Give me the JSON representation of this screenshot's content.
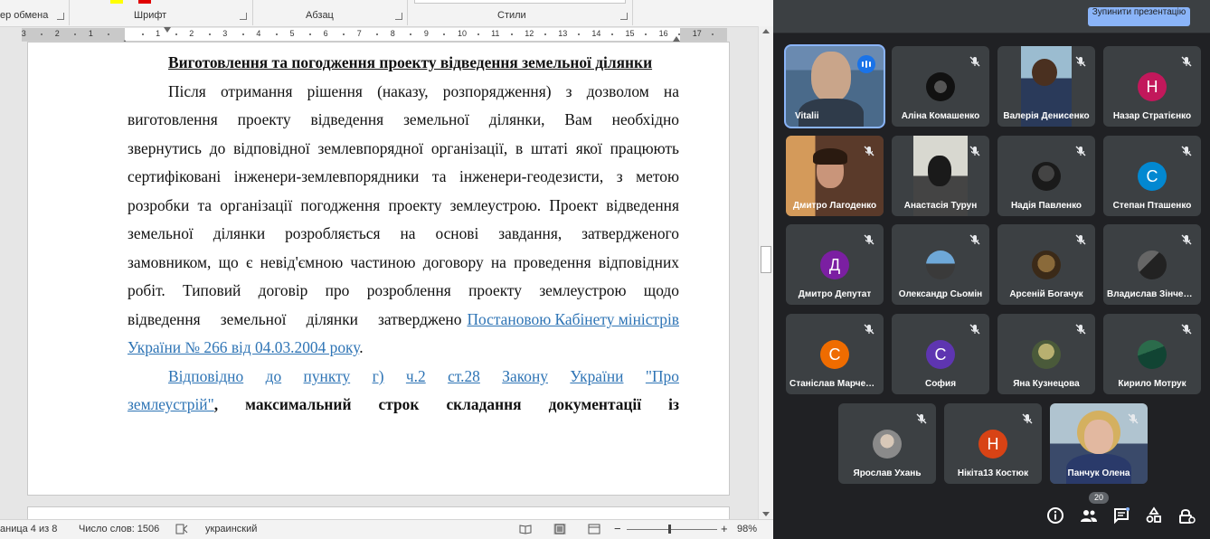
{
  "word": {
    "ribbon": {
      "groups": [
        "ер обмена",
        "Шрифт",
        "Абзац",
        "Стили"
      ]
    },
    "ruler": {
      "numbers": [
        "3",
        "2",
        "1",
        "1",
        "2",
        "3",
        "4",
        "5",
        "6",
        "7",
        "8",
        "9",
        "10",
        "11",
        "12",
        "13",
        "14",
        "15",
        "16",
        "17"
      ]
    },
    "document": {
      "heading": "Виготовлення та погодження проекту відведення земельної ділянки",
      "lines": [
        [
          "Після",
          "отримання",
          "рішення",
          "(наказу,",
          "розпорядження)",
          "з",
          "дозволом",
          "на"
        ],
        [
          "виготовлення",
          "проекту",
          "відведення",
          "земельної",
          "ділянки,",
          "Вам",
          "необхідно"
        ],
        [
          "звернутись",
          "до",
          "відповідної",
          "землевпорядної",
          "організації,",
          "в",
          "штаті",
          "якої",
          "працюють"
        ],
        [
          "сертифіковані",
          "інженери-землевпорядники",
          "та",
          "інженери-геодезисти,",
          "з",
          "метою"
        ],
        [
          "розробки",
          "та",
          "організації",
          "погодження",
          "проекту",
          "землеустрою.",
          "Проект",
          "відведення"
        ],
        [
          "земельної",
          "ділянки",
          "розробляється",
          "на",
          "основі",
          "завдання,",
          "затвердженого"
        ],
        [
          "замовником,",
          "що",
          "є",
          "невід'ємною",
          "частиною",
          "договору",
          "на",
          "проведення",
          "відповідних"
        ],
        [
          "робіт.",
          "Типовий",
          "договір",
          "про",
          "розроблення",
          "проекту",
          "землеустрою",
          "щодо"
        ],
        [
          "відведення",
          "земельної",
          "ділянки",
          "затверджено"
        ]
      ],
      "line9_link": "Постановою Кабінету міністрів",
      "line10_link": "України № 266 від 04.03.2004 року",
      "line10_tail": ".",
      "line11": [
        "Відповідно",
        "до",
        "пункту",
        "г)",
        "ч.2",
        "ст.28",
        "Закону",
        "України",
        "\"Про"
      ],
      "line12_link": "землеустрій\"",
      "line12_rest": [
        ",",
        "максимальний",
        "строк",
        "складання",
        "документації",
        "із"
      ]
    },
    "status": {
      "page": "аница 4 из 8",
      "words": "Число слов: 1506",
      "language": "украинский",
      "zoom": "98%"
    }
  },
  "meet": {
    "stop_presentation": "Зупинити презентацію",
    "participant_count": "20",
    "participants": [
      {
        "name": "Vitalii",
        "kind": "video-man",
        "speaking": true
      },
      {
        "name": "Аліна Комашенко",
        "kind": "photo",
        "photo": "dark"
      },
      {
        "name": "Валерія Денисенко",
        "kind": "video-girl"
      },
      {
        "name": "Назар Стратієнко",
        "kind": "letter",
        "letter": "Н",
        "color": "#c2185b"
      },
      {
        "name": "Дмитро Лагоденко",
        "kind": "video-boy"
      },
      {
        "name": "Анастасія Турун",
        "kind": "video-girl2"
      },
      {
        "name": "Надія Павленко",
        "kind": "photo",
        "photo": "dark2"
      },
      {
        "name": "Степан Пташенко",
        "kind": "letter",
        "letter": "С",
        "color": "#0288d1"
      },
      {
        "name": "Дмитро Депутат",
        "kind": "letter",
        "letter": "Д",
        "color": "#7b1fa2"
      },
      {
        "name": "Олександр Сьомін",
        "kind": "photo",
        "photo": "blue"
      },
      {
        "name": "Арсеній Богачук",
        "kind": "photo",
        "photo": "brown"
      },
      {
        "name": "Владислав Зінченко",
        "kind": "photo",
        "photo": "dark3"
      },
      {
        "name": "Станіслав Марченко",
        "kind": "letter",
        "letter": "С",
        "color": "#ef6c00"
      },
      {
        "name": "София",
        "kind": "letter",
        "letter": "С",
        "color": "#5e35b1"
      },
      {
        "name": "Яна Кузнецова",
        "kind": "photo",
        "photo": "olive"
      },
      {
        "name": "Кирило Мотрук",
        "kind": "photo",
        "photo": "green"
      },
      {
        "name": "Ярослав Ухань",
        "kind": "photo",
        "photo": "grey"
      },
      {
        "name": "Нікіта13 Костюк",
        "kind": "letter",
        "letter": "Н",
        "color": "#d84315"
      },
      {
        "name": "Панчук Олена",
        "kind": "video-woman"
      }
    ]
  }
}
